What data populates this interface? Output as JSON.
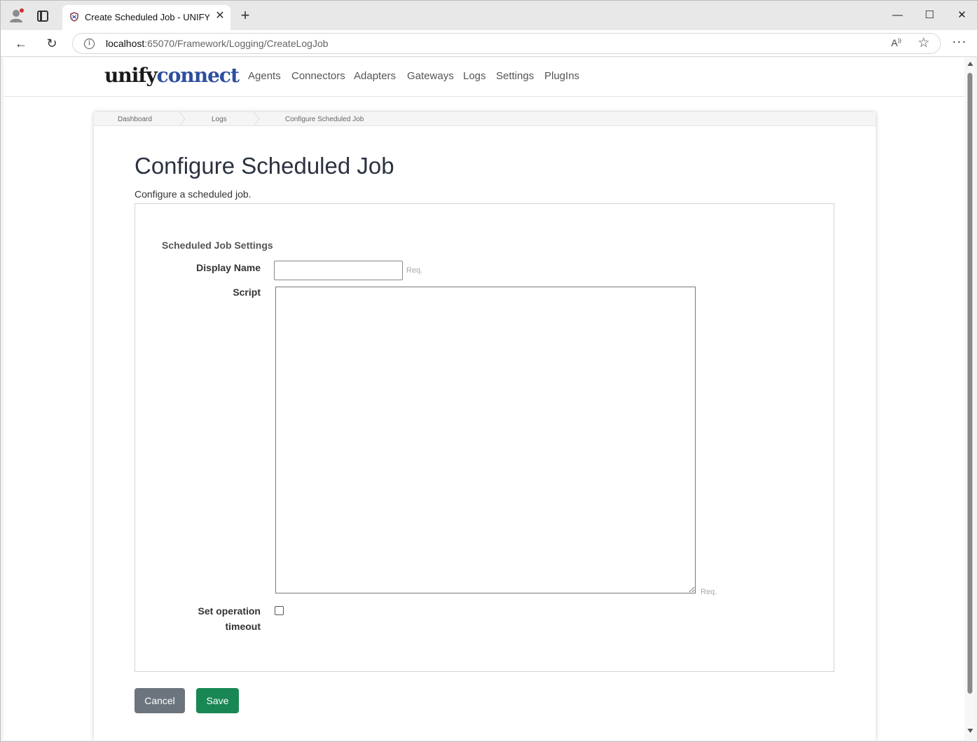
{
  "browser": {
    "tab_title": "Create Scheduled Job - UNIFYConnect",
    "url_host": "localhost",
    "url_path": ":65070/Framework/Logging/CreateLogJob",
    "window_controls": {
      "minimize": "—",
      "maximize": "☐",
      "close": "✕"
    }
  },
  "site": {
    "logo_part1": "unify",
    "logo_part2": "connect",
    "nav": [
      "Agents",
      "Connectors",
      "Adapters",
      "Gateways",
      "Logs",
      "Settings",
      "PlugIns"
    ]
  },
  "breadcrumb": [
    "Dashboard",
    "Logs",
    "Configure Scheduled Job"
  ],
  "page": {
    "title": "Configure Scheduled Job",
    "description": "Configure a scheduled job."
  },
  "form": {
    "section_title": "Scheduled Job Settings",
    "display_name_label": "Display Name",
    "display_name_value": "",
    "script_label": "Script",
    "script_value": "",
    "required_hint": "Req.",
    "timeout_label_line1": "Set operation",
    "timeout_label_line2": "timeout",
    "timeout_checked": false
  },
  "buttons": {
    "cancel": "Cancel",
    "save": "Save"
  },
  "colors": {
    "cancel_bg": "#6c757d",
    "save_bg": "#198754",
    "logo_accent": "#2e4e9e"
  }
}
